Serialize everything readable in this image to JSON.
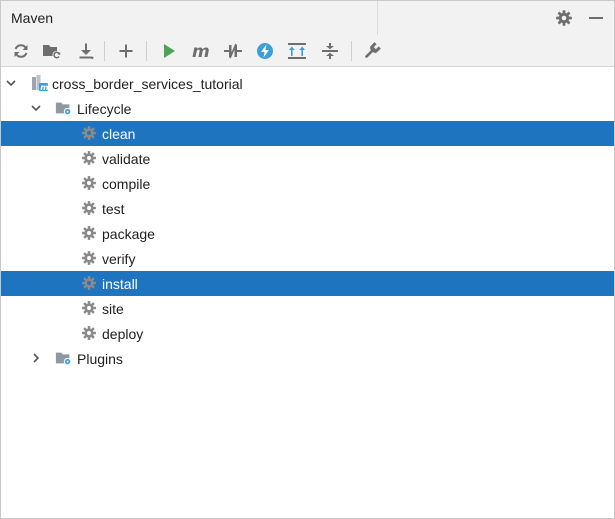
{
  "panel": {
    "title": "Maven"
  },
  "tree": {
    "project": {
      "label": "cross_border_services_tutorial"
    },
    "lifecycle": {
      "label": "Lifecycle",
      "goals": [
        {
          "label": "clean",
          "selected": true
        },
        {
          "label": "validate",
          "selected": false
        },
        {
          "label": "compile",
          "selected": false
        },
        {
          "label": "test",
          "selected": false
        },
        {
          "label": "package",
          "selected": false
        },
        {
          "label": "verify",
          "selected": false
        },
        {
          "label": "install",
          "selected": true
        },
        {
          "label": "site",
          "selected": false
        },
        {
          "label": "deploy",
          "selected": false
        }
      ]
    },
    "plugins": {
      "label": "Plugins"
    }
  },
  "colors": {
    "selection": "#1f74bf",
    "run_green": "#4ca35b",
    "icon_gray": "#6e6e6e",
    "offline_blue": "#3d9fd6"
  },
  "icons": {
    "toolbar": [
      "reload-icon",
      "generate-sources-icon",
      "download-icon",
      "add-icon",
      "run-icon",
      "execute-goal-icon",
      "toggle-offline-icon",
      "skip-tests-icon",
      "show-dependencies-icon",
      "collapse-all-icon",
      "settings-wrench-icon"
    ],
    "titlebar": [
      "gear-icon",
      "minimize-icon"
    ]
  }
}
